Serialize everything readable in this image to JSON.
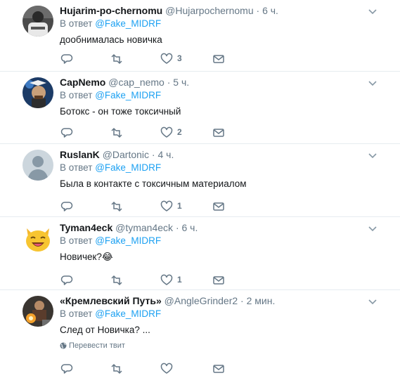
{
  "colors": {
    "accent": "#1da1f2",
    "muted": "#657786",
    "divider": "#e6ecf0",
    "text": "#14171a"
  },
  "icons": [
    "reply-icon",
    "retweet-icon",
    "like-icon",
    "dm-icon",
    "chevron-down-icon",
    "globe-icon"
  ],
  "tweets": [
    {
      "name": "Hujarim-po-chernomu",
      "handle": "@Hujarpochernomu",
      "dot": "·",
      "time": "6 ч.",
      "reply_prefix": "В ответ",
      "reply_to": "@Fake_MIDRF",
      "text": "дообнималась новичка",
      "likes": "3"
    },
    {
      "name": "CapNemo",
      "handle": "@cap_nemo",
      "dot": "·",
      "time": "5 ч.",
      "reply_prefix": "В ответ",
      "reply_to": "@Fake_MIDRF",
      "text": "Ботокс - он тоже токсичный",
      "likes": "2"
    },
    {
      "name": "RuslanK",
      "handle": "@Dartonic",
      "dot": "·",
      "time": "4 ч.",
      "reply_prefix": "В ответ",
      "reply_to": "@Fake_MIDRF",
      "text": "Была в контакте с токсичным материалом",
      "likes": "1"
    },
    {
      "name": "Tyman4eck",
      "handle": "@tyman4eck",
      "dot": "·",
      "time": "6 ч.",
      "reply_prefix": "В ответ",
      "reply_to": "@Fake_MIDRF",
      "text": "Новичек?😂",
      "likes": "1"
    },
    {
      "name": "«Кремлевский Путь»",
      "handle": "@AngleGrinder2",
      "dot": "·",
      "time": "2 мин.",
      "reply_prefix": "В ответ",
      "reply_to": "@Fake_MIDRF",
      "text": "След от Новичка? ...",
      "translate": "Перевести твит",
      "likes": ""
    }
  ]
}
